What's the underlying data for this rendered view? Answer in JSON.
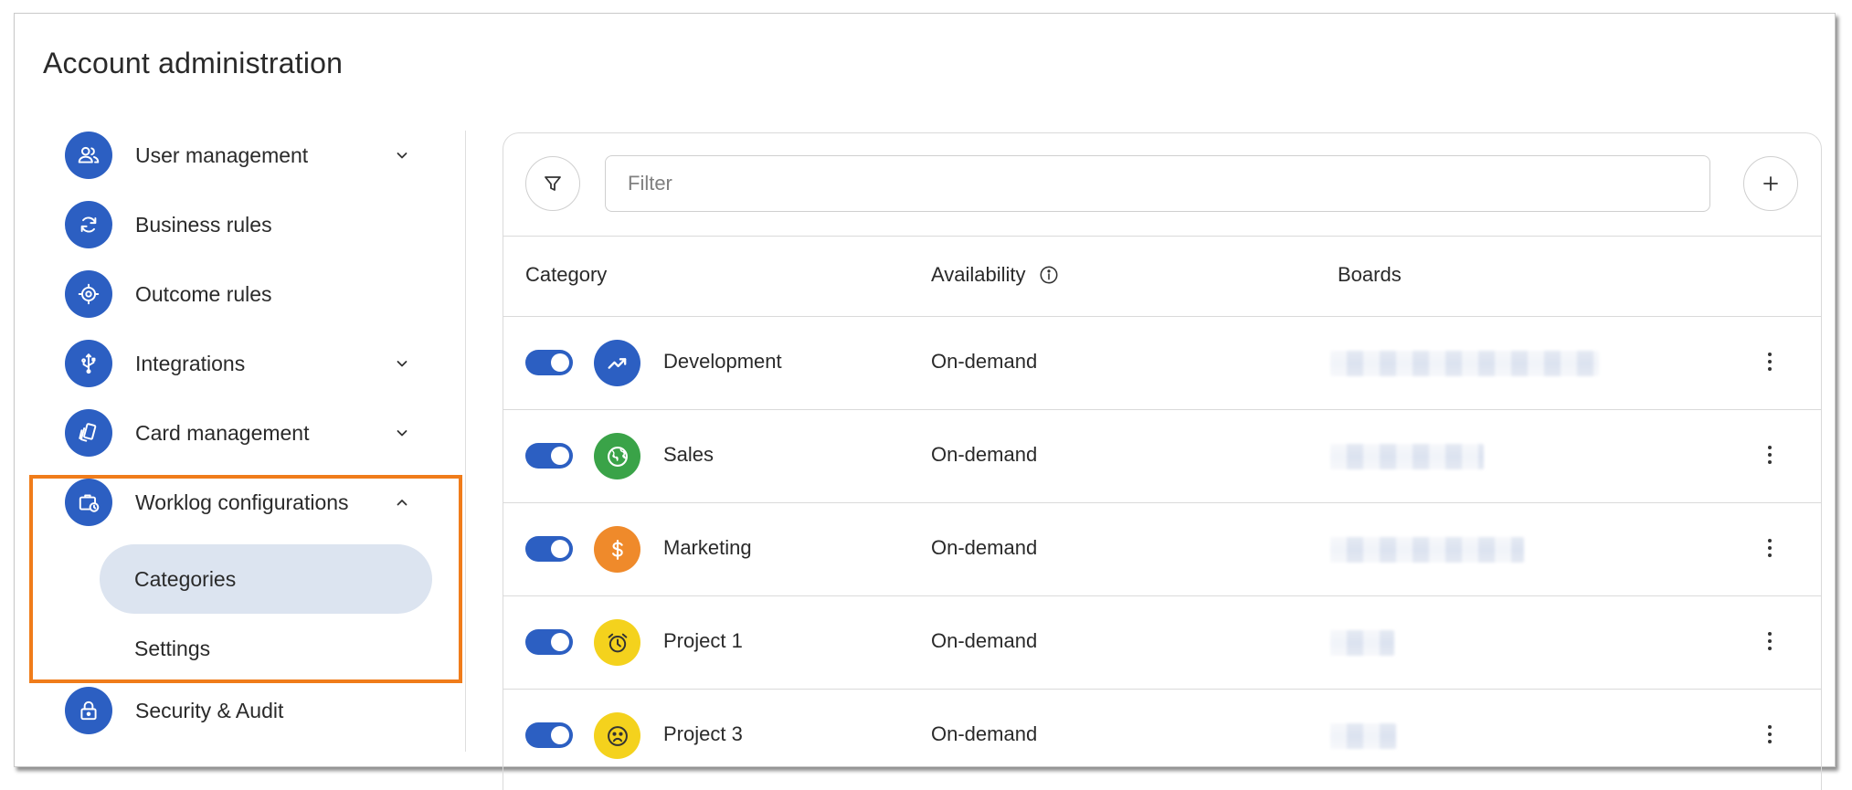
{
  "page": {
    "title": "Account administration"
  },
  "sidebar": {
    "items": [
      {
        "label": "User management",
        "icon": "users-icon",
        "expandable": true,
        "expanded": false
      },
      {
        "label": "Business rules",
        "icon": "refresh-icon",
        "expandable": false
      },
      {
        "label": "Outcome rules",
        "icon": "target-icon",
        "expandable": false
      },
      {
        "label": "Integrations",
        "icon": "usb-icon",
        "expandable": true,
        "expanded": false
      },
      {
        "label": "Card management",
        "icon": "cards-icon",
        "expandable": true,
        "expanded": false
      },
      {
        "label": "Worklog configurations",
        "icon": "briefcase-clock-icon",
        "expandable": true,
        "expanded": true,
        "children": [
          {
            "label": "Categories",
            "active": true
          },
          {
            "label": "Settings",
            "active": false
          }
        ]
      },
      {
        "label": "Security & Audit",
        "icon": "lock-icon",
        "expandable": false
      }
    ]
  },
  "toolbar": {
    "filter_placeholder": "Filter",
    "filter_value": ""
  },
  "table": {
    "columns": [
      "Category",
      "Availability",
      "Boards"
    ],
    "rows": [
      {
        "enabled": true,
        "name": "Development",
        "availability": "On-demand",
        "icon": "trending-up-icon",
        "color": "#2c5fc2"
      },
      {
        "enabled": true,
        "name": "Sales",
        "availability": "On-demand",
        "icon": "globe-icon",
        "color": "#3aa348"
      },
      {
        "enabled": true,
        "name": "Marketing",
        "availability": "On-demand",
        "icon": "dollar-icon",
        "color": "#ef8a2b"
      },
      {
        "enabled": true,
        "name": "Project 1",
        "availability": "On-demand",
        "icon": "alarm-clock-icon",
        "color": "#f4d21d"
      },
      {
        "enabled": true,
        "name": "Project 3",
        "availability": "On-demand",
        "icon": "sad-face-icon",
        "color": "#f4d21d"
      }
    ]
  },
  "colors": {
    "primary": "#2c5fc2",
    "highlight": "#f07c1a",
    "active_item_bg": "#dce4f0"
  }
}
